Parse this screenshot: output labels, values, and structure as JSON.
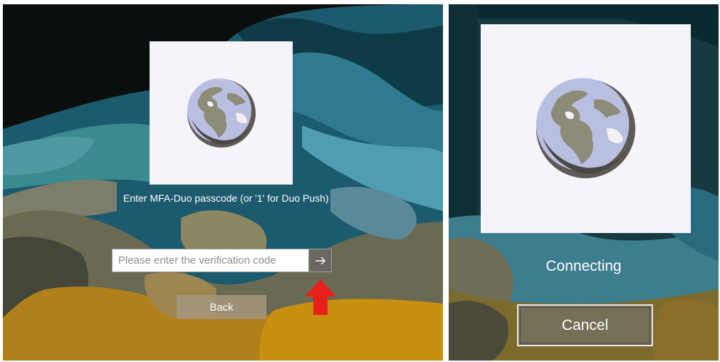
{
  "left_screen": {
    "prompt": "Enter MFA-Duo passcode (or '1' for Duo Push)",
    "code_input": {
      "value": "",
      "placeholder": "Please enter the verification code"
    },
    "submit_icon": "arrow-right-icon",
    "back_label": "Back",
    "annotation_icon": "red-up-arrow-icon"
  },
  "right_screen": {
    "status": "Connecting",
    "cancel_label": "Cancel"
  },
  "logo_icon": "globe-icon",
  "colors": {
    "tile": "#f6f4fb",
    "annotation_red": "#e8201c",
    "submit_bg": "#6a6660"
  }
}
